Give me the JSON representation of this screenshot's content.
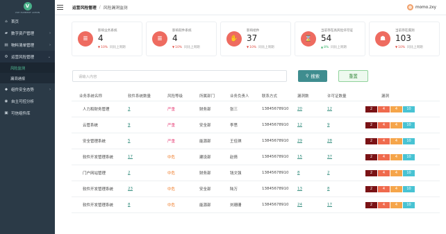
{
  "sidebar": {
    "logo_letter": "V",
    "brand_name": "VUE ELEMENT ADMIN",
    "items": [
      {
        "label": "首页",
        "icon": "home-icon",
        "glyph": "⌂"
      },
      {
        "label": "数字资产管理",
        "icon": "folder-icon",
        "glyph": "▰",
        "chevron": "›"
      },
      {
        "label": "物料清单管理",
        "icon": "document-icon",
        "glyph": "▤",
        "chevron": "›"
      },
      {
        "label": "运营风险管理",
        "icon": "settings-icon",
        "glyph": "⚙",
        "chevron": "⌄"
      },
      {
        "label": "组件安全态势",
        "icon": "shield-icon",
        "glyph": "◆",
        "chevron": "›"
      },
      {
        "label": "自主可控分析",
        "icon": "target-icon",
        "glyph": "◉"
      },
      {
        "label": "可信组件库",
        "icon": "library-icon",
        "glyph": "▣"
      }
    ],
    "sub_items": [
      {
        "label": "风险监测"
      },
      {
        "label": "漏洞通报"
      }
    ]
  },
  "header": {
    "breadcrumb_root": "运营风险管理",
    "breadcrumb_sep": "/",
    "breadcrumb_current": "风险漏洞监测",
    "username": "momo.zxy"
  },
  "cards": [
    {
      "label": "影响业务系统",
      "value": "4",
      "trend_dir": "▼",
      "trend_pct": "10%",
      "trend_text": "同比上周期",
      "color": "#ee6b60",
      "icon": "database-icon",
      "glyph": "≣"
    },
    {
      "label": "影响软件系统",
      "value": "4",
      "trend_dir": "▼",
      "trend_pct": "10%",
      "trend_text": "同比上周期",
      "color": "#ee6b60",
      "icon": "database-icon",
      "glyph": "≣"
    },
    {
      "label": "影响组件",
      "value": "37",
      "trend_dir": "▼",
      "trend_pct": "10%",
      "trend_text": "同比上周期",
      "color": "#ee6b60",
      "icon": "thumb-down-icon",
      "glyph": "✋"
    },
    {
      "label": "当前存在高风险许可证",
      "value": "54",
      "trend_dir": "▲",
      "trend_pct": "8%",
      "trend_text": "同比上周期",
      "color": "#ee6b60",
      "icon": "hourglass-icon",
      "glyph": "⌛"
    },
    {
      "label": "当前存在漏洞",
      "value": "103",
      "trend_dir": "▼",
      "trend_pct": "10%",
      "trend_text": "同比上周期",
      "color": "#ee6b60",
      "icon": "bug-icon",
      "glyph": "☗"
    }
  ],
  "search": {
    "placeholder": "请输入内容",
    "search_label": "搜索",
    "reset_label": "重置"
  },
  "table": {
    "headers": [
      "业务系统名称",
      "软件系统数量",
      "风险等级",
      "所属部门",
      "业务负责人",
      "联系方式",
      "漏洞数",
      "许可证数量",
      "漏洞"
    ],
    "rows": [
      {
        "name": "人力和财务管理",
        "software": "3",
        "level": "严重",
        "level_type": "high",
        "dept": "财务部",
        "owner": "张三",
        "phone": "13845678910",
        "vulns": "20",
        "licenses": "12",
        "b": [
          "2",
          "4",
          "4",
          "10"
        ]
      },
      {
        "name": "云管系统",
        "software": "9",
        "level": "严重",
        "level_type": "high",
        "dept": "安全部",
        "owner": "李思",
        "phone": "13845678910",
        "vulns": "12",
        "licenses": "9",
        "b": [
          "2",
          "4",
          "4",
          "10"
        ]
      },
      {
        "name": "安全管理系统",
        "software": "5",
        "level": "严重",
        "level_type": "high",
        "dept": "能源部",
        "owner": "王佳琪",
        "phone": "13845678910",
        "vulns": "29",
        "licenses": "28",
        "b": [
          "2",
          "4",
          "4",
          "10"
        ]
      },
      {
        "name": "软件开发管理系统",
        "software": "17",
        "level": "中危",
        "level_type": "mid",
        "dept": "建设部",
        "owner": "赵倩",
        "phone": "13845678910",
        "vulns": "15",
        "licenses": "37",
        "b": [
          "2",
          "4",
          "4",
          "10"
        ]
      },
      {
        "name": "门户网站管理",
        "software": "2",
        "level": "中危",
        "level_type": "mid",
        "dept": "财务部",
        "owner": "钱文强",
        "phone": "13845678910",
        "vulns": "8",
        "licenses": "2",
        "b": [
          "2",
          "4",
          "4",
          "10"
        ]
      },
      {
        "name": "软件开发管理系统",
        "software": "23",
        "level": "中危",
        "level_type": "mid",
        "dept": "安全部",
        "owner": "陆万",
        "phone": "13845678910",
        "vulns": "13",
        "licenses": "8",
        "b": [
          "2",
          "4",
          "4",
          "10"
        ]
      },
      {
        "name": "软件开发管理系统",
        "software": "8",
        "level": "中危",
        "level_type": "mid",
        "dept": "能源部",
        "owner": "刘珊珊",
        "phone": "13845678910",
        "vulns": "24",
        "licenses": "17",
        "b": [
          "2",
          "4",
          "4",
          "10"
        ]
      }
    ],
    "badge_colors": [
      "#7a1215",
      "#ef6a4d",
      "#f5a54a",
      "#48c3d3"
    ]
  }
}
